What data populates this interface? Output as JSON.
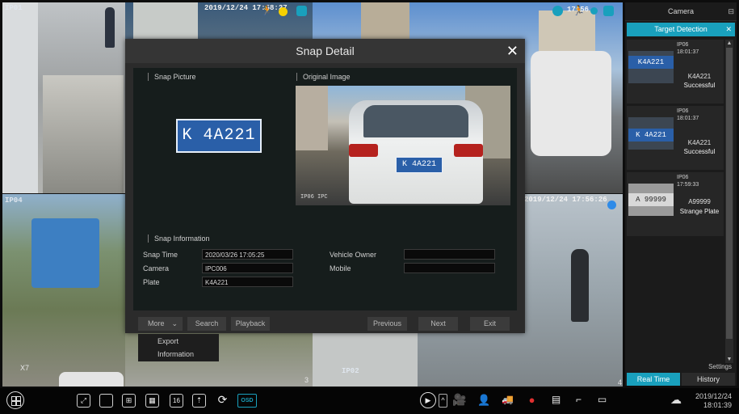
{
  "cameras": {
    "cam1_label": "IP01",
    "cam2_timestamp": "2019/12/24 17:58:27",
    "cam2_number": "3",
    "cam3_timestamp": "17:56",
    "cam3_number": "4",
    "cam4_label": "IP04",
    "cam4_number": "X7",
    "cam5_label": "IP02",
    "cam6_timestamp": "2019/12/24 17:56:26"
  },
  "dialog": {
    "title": "Snap Detail",
    "close_icon": "close-icon",
    "snap_picture_label": "Snap Picture",
    "snap_plate_text": "K 4A221",
    "original_image_label": "Original Image",
    "original_plate_text": "K 4A221",
    "original_osd": "IP06 IPC",
    "snap_information_label": "Snap Information",
    "fields": {
      "snap_time_label": "Snap Time",
      "snap_time_value": "2020/03/26 17:05:25",
      "camera_label": "Camera",
      "camera_value": "IPC006",
      "plate_label": "Plate",
      "plate_value": "K4A221",
      "vehicle_owner_label": "Vehicle Owner",
      "vehicle_owner_value": "",
      "mobile_label": "Mobile",
      "mobile_value": ""
    },
    "footer": {
      "more_label": "More",
      "search_label": "Search",
      "playback_label": "Playback",
      "previous_label": "Previous",
      "next_label": "Next",
      "exit_label": "Exit"
    }
  },
  "more_menu": {
    "items": [
      "Export",
      "Information"
    ]
  },
  "right_panel": {
    "title": "Camera",
    "tab_label": "Target Detection",
    "cards": [
      {
        "camera": "IP06",
        "time": "18:01:37",
        "plate_thumb": "K4A221",
        "plate": "K4A221",
        "result": "Successful"
      },
      {
        "camera": "IP06",
        "time": "18:01:37",
        "plate_thumb": "K 4A221",
        "plate": "K4A221",
        "result": "Successful"
      },
      {
        "camera": "IP06",
        "time": "17:59:33",
        "plate_thumb": "A 99999",
        "plate": "A99999",
        "result": "Strange Plate"
      }
    ],
    "settings_label": "Settings",
    "tabs": {
      "realtime": "Real Time",
      "history": "History"
    }
  },
  "toolbar": {
    "osd_label": "OSD",
    "date": "2019/12/24",
    "time": "18:01:39",
    "split_16": "16"
  },
  "colors": {
    "accent": "#19a0bd",
    "dialog_bg": "#2b2b2b",
    "panel_bg": "#1b1b1b"
  }
}
